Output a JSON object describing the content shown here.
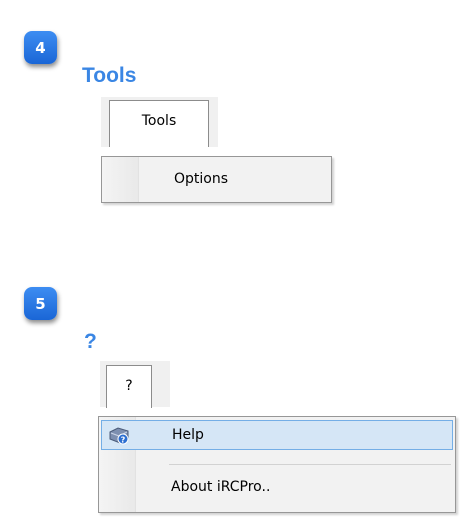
{
  "sections": [
    {
      "badge": "4",
      "title": "Tools",
      "menu_tab": "Tools",
      "items": [
        {
          "label": "Options"
        }
      ]
    },
    {
      "badge": "5",
      "title": "?",
      "menu_tab": "?",
      "items": [
        {
          "label": "Help",
          "icon": "help-book-icon",
          "highlighted": true
        },
        {
          "label": "About iRCPro..",
          "highlighted": false
        }
      ]
    }
  ],
  "colors": {
    "badge": "#2b7be8",
    "title": "#3a86e4",
    "highlight_fill": "#d5e6f6",
    "highlight_border": "#74aee6"
  }
}
